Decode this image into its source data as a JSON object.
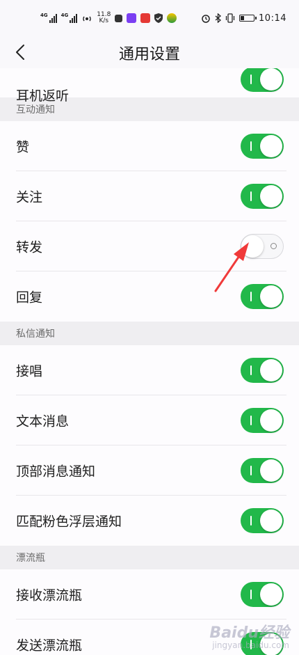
{
  "status_bar": {
    "network_1": "4G",
    "network_2": "4G",
    "speed_value": "11.8",
    "speed_unit": "K/s",
    "time": "10:14"
  },
  "header": {
    "title": "通用设置"
  },
  "partial_row": {
    "label": "耳机返听",
    "toggle": "on"
  },
  "sections": [
    {
      "title": "互动通知",
      "items": [
        {
          "label": "赞",
          "toggle": "on"
        },
        {
          "label": "关注",
          "toggle": "on"
        },
        {
          "label": "转发",
          "toggle": "off"
        },
        {
          "label": "回复",
          "toggle": "on"
        }
      ]
    },
    {
      "title": "私信通知",
      "items": [
        {
          "label": "接唱",
          "toggle": "on"
        },
        {
          "label": "文本消息",
          "toggle": "on"
        },
        {
          "label": "顶部消息通知",
          "toggle": "on"
        },
        {
          "label": "匹配粉色浮层通知",
          "toggle": "on"
        }
      ]
    },
    {
      "title": "漂流瓶",
      "items": [
        {
          "label": "接收漂流瓶",
          "toggle": "on"
        },
        {
          "label": "发送漂流瓶",
          "toggle": "on"
        }
      ]
    }
  ],
  "watermark": {
    "main": "Baidu经验",
    "sub": "jingyan.baidu.com"
  },
  "colors": {
    "toggle_on": "#22b84a",
    "annotation_arrow": "#f03a3a",
    "section_bg": "#efeef1"
  }
}
